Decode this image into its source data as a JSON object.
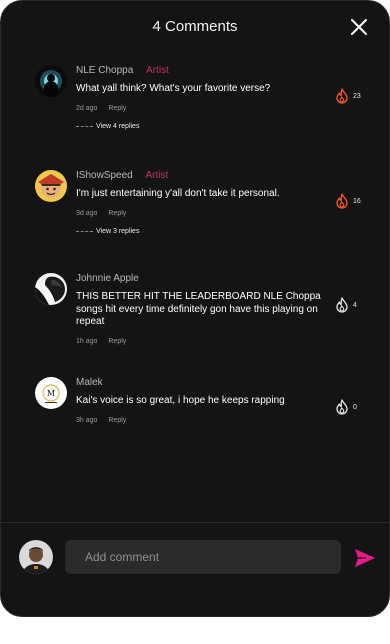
{
  "header": {
    "title": "4 Comments"
  },
  "comments": [
    {
      "name": "NLE Choppa",
      "role": "Artist",
      "text": "What yall think? What's your favorite verse?",
      "time": "2d ago",
      "reply": "Reply",
      "replies": "View 4 replies",
      "likes": "23",
      "liked": true
    },
    {
      "name": "IShowSpeed",
      "role": "Artist",
      "text": "I'm just entertaining y'all don't take it personal.",
      "time": "3d ago",
      "reply": "Reply",
      "replies": "View 3 replies",
      "likes": "16",
      "liked": true
    },
    {
      "name": "Johnnie Apple",
      "text": "THIS BETTER HIT THE LEADERBOARD NLE Choppa songs hit every time definitely gon have this playing on repeat",
      "time": "1h ago",
      "reply": "Reply",
      "likes": "4",
      "liked": false
    },
    {
      "name": "Malek",
      "text": "Kai's voice is so great, i hope he keeps rapping",
      "time": "3h ago",
      "reply": "Reply",
      "likes": "0",
      "liked": false
    }
  ],
  "footer": {
    "placeholder": "Add comment"
  },
  "colors": {
    "accent": "#e6198c",
    "artist": "#c2336e",
    "flame_active": "#ff5a1f"
  },
  "icons": [
    "close-icon",
    "flame-icon",
    "send-icon"
  ]
}
